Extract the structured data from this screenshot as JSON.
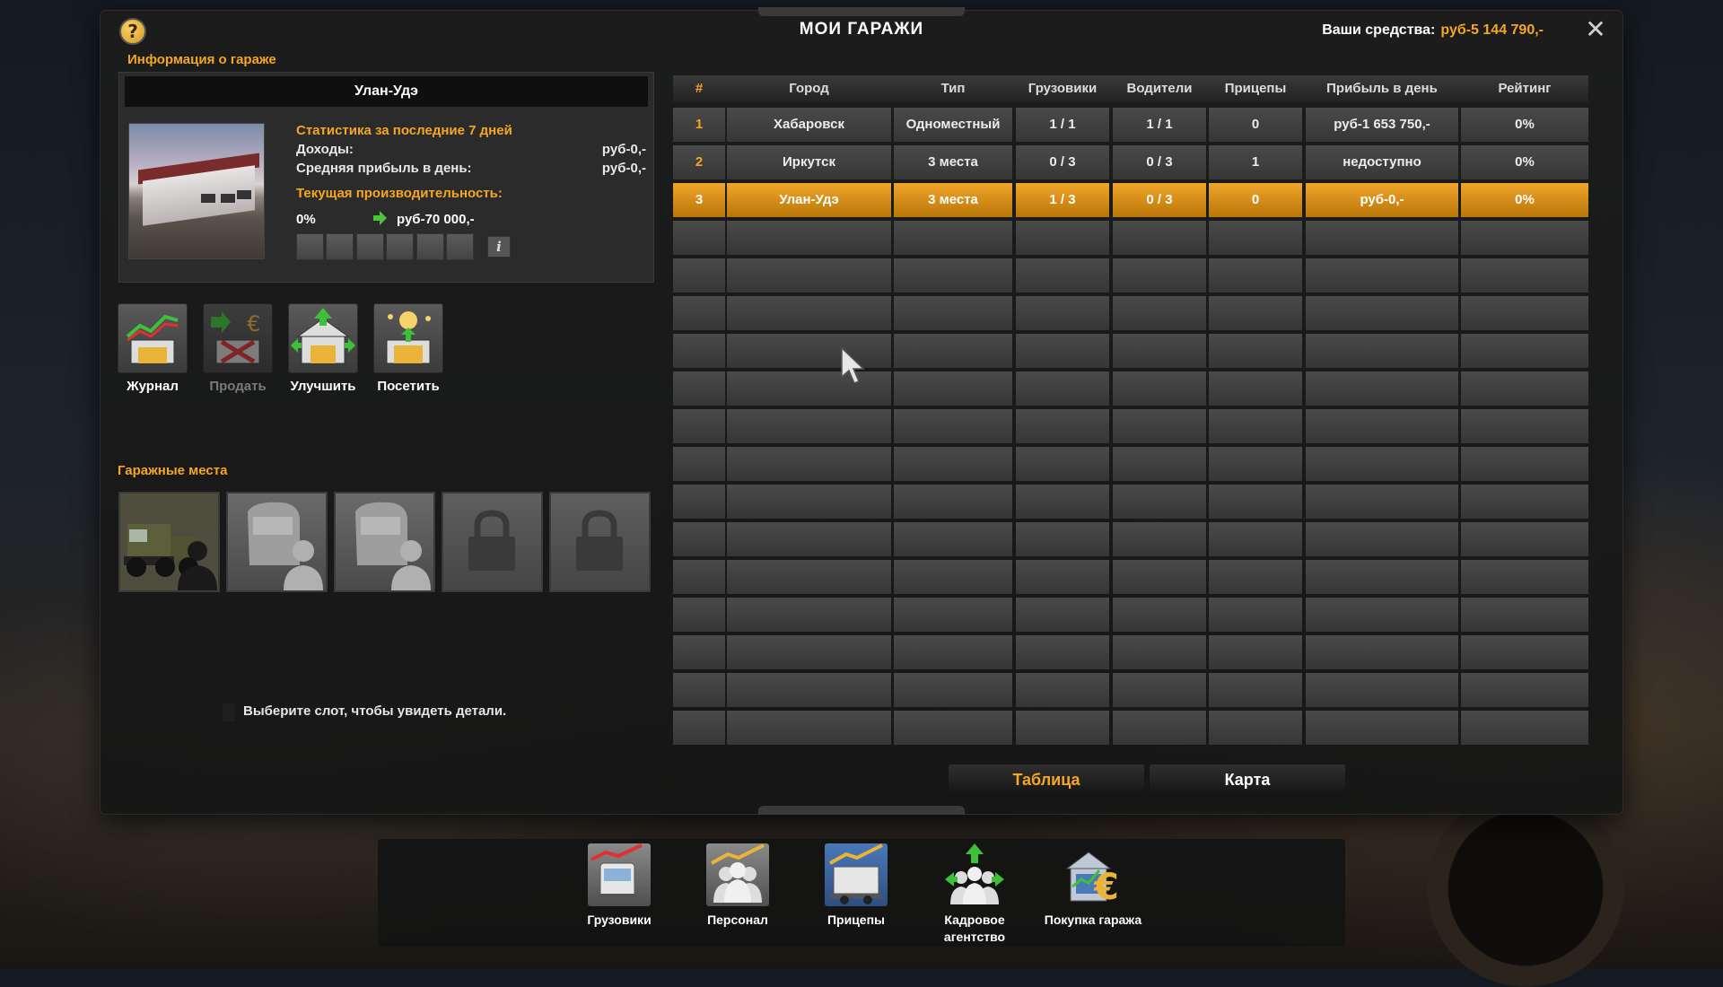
{
  "window": {
    "title": "МОИ ГАРАЖИ",
    "funds_label": "Ваши средства:",
    "funds_value": "руб-5 144 790,-"
  },
  "info": {
    "section_label": "Информация о гараже",
    "garage_name": "Улан-Удэ",
    "stats_title": "Статистика за последние 7 дней",
    "income_label": "Доходы:",
    "income_value": "руб-0,-",
    "avg_profit_label": "Средняя прибыль в день:",
    "avg_profit_value": "руб-0,-",
    "productivity_title": "Текущая производительность:",
    "productivity_pct": "0%",
    "productivity_value": "руб-70 000,-",
    "productivity_level": 0
  },
  "actions": [
    {
      "label": "Журнал",
      "icon": "journal-icon",
      "enabled": true
    },
    {
      "label": "Продать",
      "icon": "sell-garage-icon",
      "enabled": false
    },
    {
      "label": "Улучшить",
      "icon": "upgrade-icon",
      "enabled": true
    },
    {
      "label": "Посетить",
      "icon": "visit-icon",
      "enabled": true
    }
  ],
  "slots": {
    "section_label": "Гаражные места",
    "items": [
      {
        "state": "truck-with-driver",
        "icon": "truck-driver-icon"
      },
      {
        "state": "empty",
        "icon": "empty-slot-icon"
      },
      {
        "state": "empty",
        "icon": "empty-slot-icon"
      },
      {
        "state": "locked",
        "icon": "lock-icon"
      },
      {
        "state": "locked",
        "icon": "lock-icon"
      }
    ],
    "hint": "Выберите слот, чтобы увидеть детали."
  },
  "table": {
    "headers": [
      "#",
      "Город",
      "Тип",
      "Грузовики",
      "Водители",
      "Прицепы",
      "Прибыль в день",
      "Рейтинг"
    ],
    "rows": [
      [
        "1",
        "Хабаровск",
        "Одноместный",
        "1 / 1",
        "1 / 1",
        "0",
        "руб-1 653 750,-",
        "0%"
      ],
      [
        "2",
        "Иркутск",
        "3 места",
        "0 / 3",
        "0 / 3",
        "1",
        "недоступно",
        "0%"
      ],
      [
        "3",
        "Улан-Удэ",
        "3 места",
        "1 / 3",
        "0 / 3",
        "0",
        "руб-0,-",
        "0%"
      ]
    ],
    "selected_row": 2
  },
  "view_tabs": [
    {
      "label": "Таблица",
      "active": true
    },
    {
      "label": "Карта",
      "active": false
    }
  ],
  "bottom_nav": [
    {
      "label": "Грузовики",
      "icon": "trucks-icon"
    },
    {
      "label": "Персонал",
      "icon": "staff-icon"
    },
    {
      "label": "Прицепы",
      "icon": "trailers-icon"
    },
    {
      "label": "Кадровое агентство",
      "icon": "recruitment-agency-icon"
    },
    {
      "label": "Покупка гаража",
      "icon": "buy-garage-icon"
    }
  ],
  "colors": {
    "accent": "#f5a623",
    "selected_row": "#d4900f",
    "panel": "#2b2b2b"
  }
}
